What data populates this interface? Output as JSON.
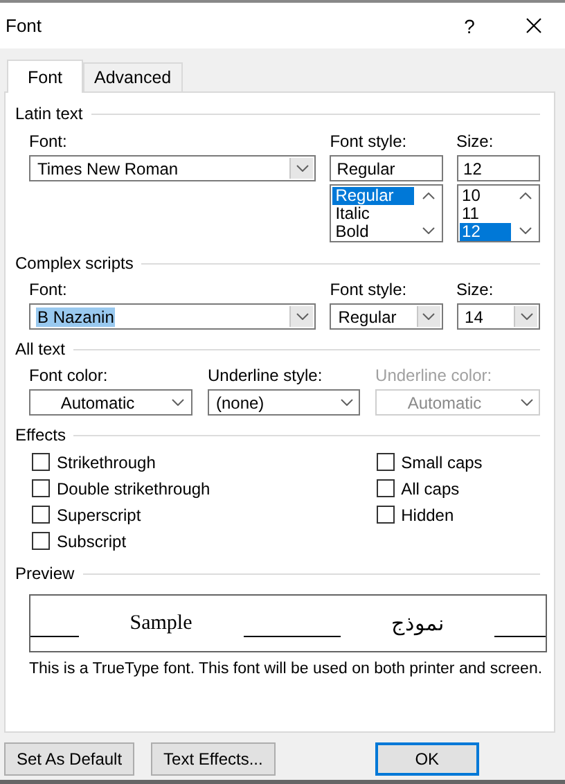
{
  "window": {
    "title": "Font",
    "help": "?"
  },
  "tabs": [
    {
      "label": "Font",
      "selected": true
    },
    {
      "label": "Advanced",
      "selected": false
    }
  ],
  "latin_text": {
    "heading": "Latin text",
    "font": {
      "label": "Font:",
      "value": "Times New Roman"
    },
    "font_style": {
      "label": "Font style:",
      "value": "Regular",
      "options": [
        {
          "label": "Regular",
          "selected": true
        },
        {
          "label": "Italic",
          "selected": false
        },
        {
          "label": "Bold",
          "selected": false
        }
      ]
    },
    "size": {
      "label": "Size:",
      "value": "12",
      "options": [
        {
          "label": "10",
          "selected": false
        },
        {
          "label": "11",
          "selected": false
        },
        {
          "label": "12",
          "selected": true
        }
      ]
    }
  },
  "complex_scripts": {
    "heading": "Complex scripts",
    "font": {
      "label": "Font:",
      "value": "B Nazanin",
      "highlighted": true
    },
    "font_style": {
      "label": "Font style:",
      "value": "Regular",
      "highlighted": false
    },
    "size": {
      "label": "Size:",
      "value": "14",
      "highlighted": false
    }
  },
  "all_text": {
    "heading": "All text",
    "font_color": {
      "label": "Font color:",
      "value": "Automatic",
      "disabled": false
    },
    "underline_style": {
      "label": "Underline style:",
      "value": "(none)",
      "disabled": false
    },
    "underline_color": {
      "label": "Underline color:",
      "value": "Automatic",
      "disabled": true
    }
  },
  "effects": {
    "heading": "Effects",
    "left": [
      {
        "label": "Strikethrough",
        "checked": false
      },
      {
        "label": "Double strikethrough",
        "checked": false
      },
      {
        "label": "Superscript",
        "checked": false
      },
      {
        "label": "Subscript",
        "checked": false
      }
    ],
    "right": [
      {
        "label": "Small caps",
        "checked": false
      },
      {
        "label": "All caps",
        "checked": false
      },
      {
        "label": "Hidden",
        "checked": false
      }
    ]
  },
  "preview": {
    "heading": "Preview",
    "latin_sample": "Sample",
    "complex_sample": "نموذج",
    "note": "This is a TrueType font. This font will be used on both printer and screen."
  },
  "buttons": [
    {
      "label": "Set As Default",
      "default": false
    },
    {
      "label": "Text Effects...",
      "default": false
    },
    {
      "label": "OK",
      "default": true
    }
  ]
}
